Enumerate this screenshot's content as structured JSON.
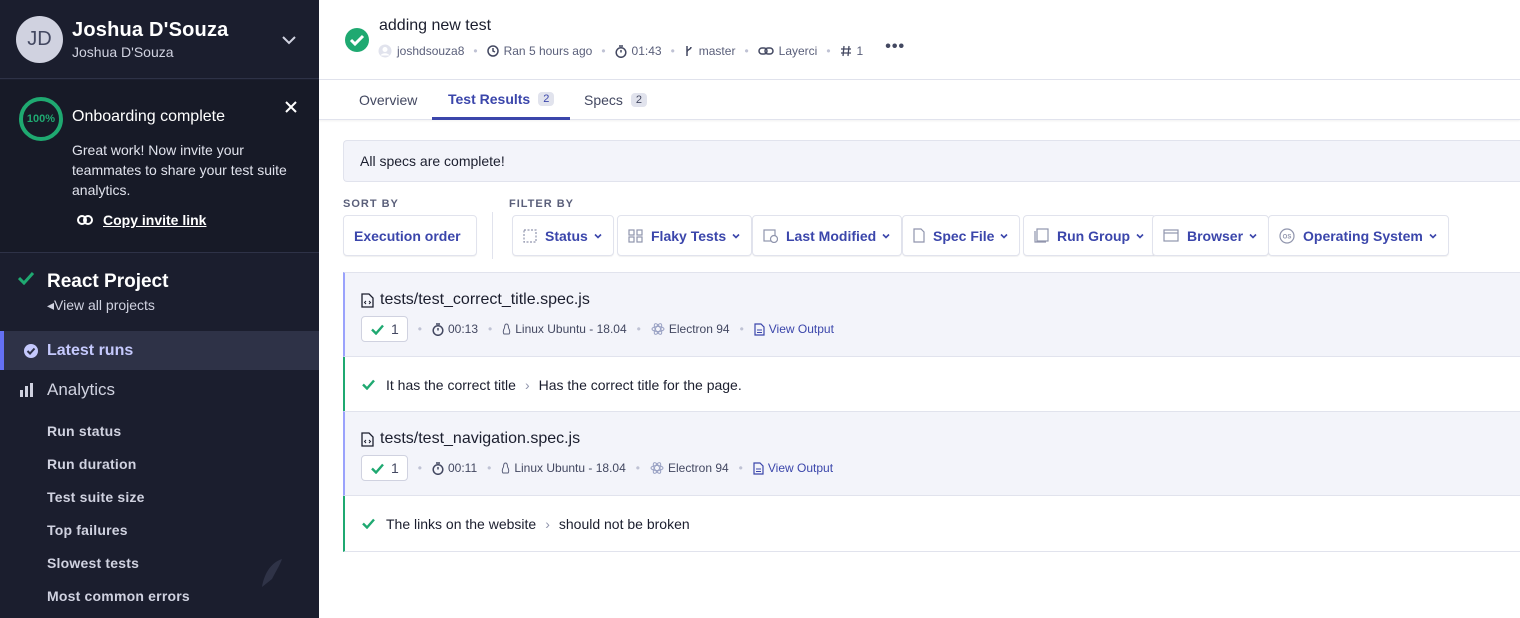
{
  "sidebar": {
    "user": {
      "initials": "JD",
      "name": "Joshua D'Souza",
      "org": "Joshua D'Souza"
    },
    "onboarding": {
      "percent": "100%",
      "title": "Onboarding complete",
      "text": "Great work! Now invite your teammates to share your test suite analytics.",
      "link": "Copy invite link"
    },
    "project": {
      "name": "React Project",
      "view_all": "View all projects"
    },
    "nav": {
      "latest_runs": "Latest runs",
      "analytics": "Analytics"
    },
    "subnav": [
      "Run status",
      "Run duration",
      "Test suite size",
      "Top failures",
      "Slowest tests",
      "Most common errors"
    ]
  },
  "header": {
    "title": "adding new test",
    "author": "joshdsouza8",
    "ran": "Ran 5 hours ago",
    "duration": "01:43",
    "branch": "master",
    "ci": "Layerci",
    "run_number": "1"
  },
  "tabs": [
    {
      "label": "Overview",
      "count": ""
    },
    {
      "label": "Test Results",
      "count": "2"
    },
    {
      "label": "Specs",
      "count": "2"
    }
  ],
  "banner": "All specs are complete!",
  "sort": {
    "label": "SORT BY",
    "value": "Execution order"
  },
  "filter": {
    "label": "FILTER BY",
    "buttons": [
      "Status",
      "Flaky Tests",
      "Last Modified",
      "Spec File",
      "Run Group",
      "Browser",
      "Operating System"
    ]
  },
  "specs": [
    {
      "file": "tests/test_correct_title.spec.js",
      "passed": "1",
      "duration": "00:13",
      "os": "Linux Ubuntu - 18.04",
      "browser": "Electron 94",
      "output": "View Output",
      "test": {
        "suite": "It has the correct title",
        "name": "Has the correct title for the page."
      }
    },
    {
      "file": "tests/test_navigation.spec.js",
      "passed": "1",
      "duration": "00:11",
      "os": "Linux Ubuntu - 18.04",
      "browser": "Electron 94",
      "output": "View Output",
      "test": {
        "suite": "The links on the website",
        "name": "should not be broken"
      }
    }
  ],
  "colors": {
    "accent": "#3b46ab",
    "success": "#1fa971",
    "sidebar": "#1b1e2e"
  }
}
